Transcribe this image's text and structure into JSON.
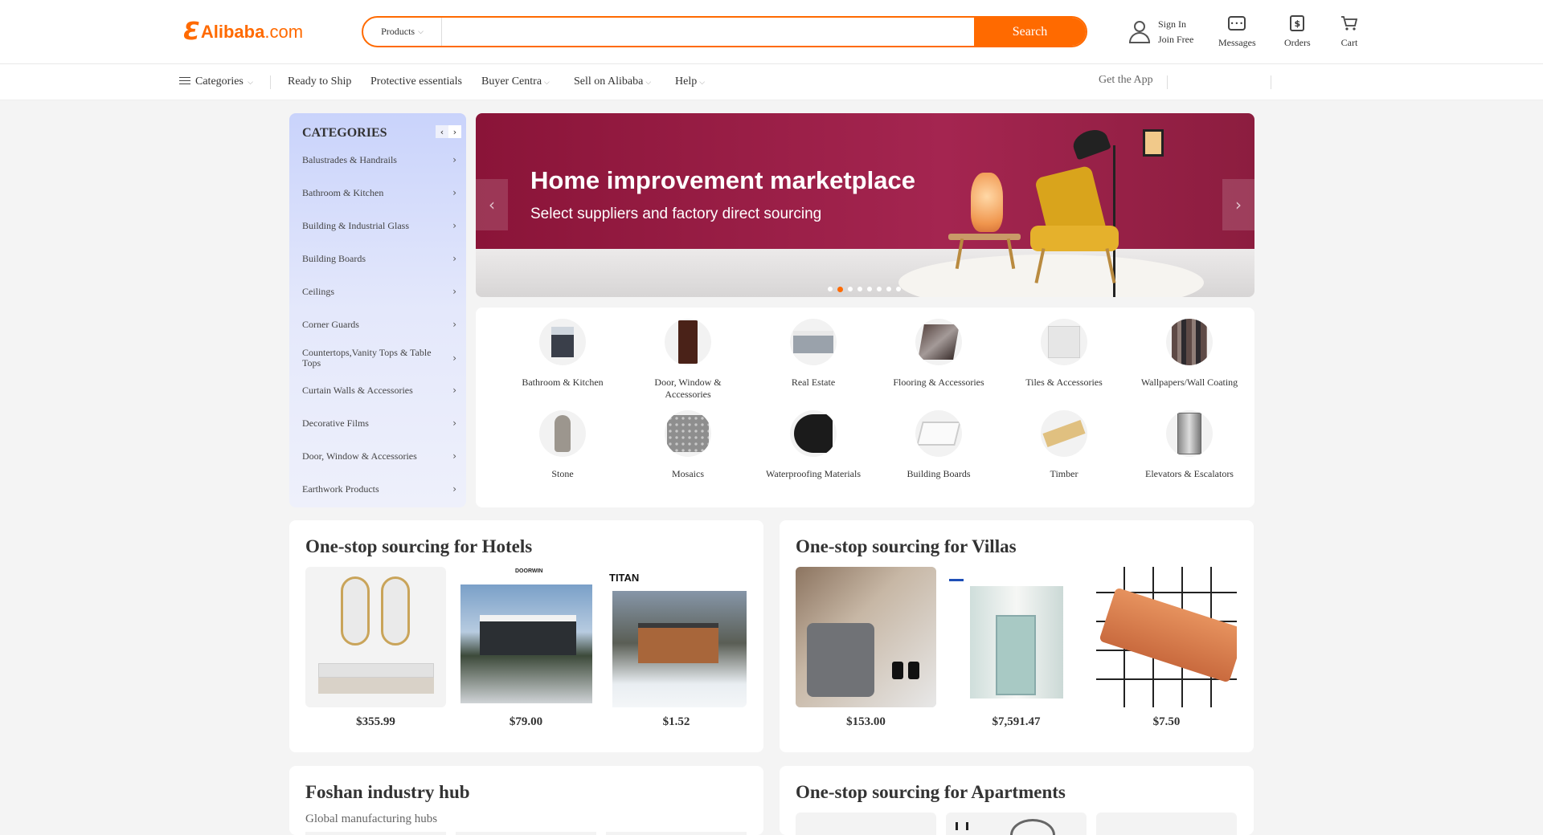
{
  "header": {
    "logo": {
      "mark": "Ɛ",
      "name": "Alibaba",
      "suffix": ".com"
    },
    "search": {
      "type_label": "Products",
      "placeholder": "",
      "button_label": "Search"
    },
    "user": {
      "sign_in": "Sign In",
      "join": "Join Free"
    },
    "tools": [
      {
        "label": "Messages",
        "icon": "message-icon"
      },
      {
        "label": "Orders",
        "icon": "orders-icon"
      },
      {
        "label": "Cart",
        "icon": "cart-icon"
      }
    ]
  },
  "subnav": {
    "categories": "Categories",
    "ready_to_ship": "Ready to Ship",
    "protective": "Protective essentials",
    "buyer_central": "Buyer Centra",
    "sell": "Sell on Alibaba",
    "help": "Help",
    "get_app": "Get the App"
  },
  "categories_panel": {
    "title": "CATEGORIES",
    "items": [
      "Balustrades & Handrails",
      "Bathroom & Kitchen",
      "Building & Industrial Glass",
      "Building Boards",
      "Ceilings",
      "Corner Guards",
      "Countertops,Vanity Tops & Table Tops",
      "Curtain Walls & Accessories",
      "Decorative Films",
      "Door, Window & Accessories",
      "Earthwork Products"
    ]
  },
  "banner": {
    "title": "Home improvement marketplace",
    "subtitle": "Select suppliers and factory direct sourcing",
    "slide_count": 8,
    "active_slide": 1
  },
  "category_grid": [
    "Bathroom & Kitchen",
    "Door, Window & Accessories",
    "Real Estate",
    "Flooring & Accessories",
    "Tiles & Accessories",
    "Wallpapers/Wall Coating",
    "Stone",
    "Mosaics",
    "Waterproofing Materials",
    "Building Boards",
    "Timber",
    "Elevators & Escalators"
  ],
  "hotels": {
    "title": "One-stop sourcing for Hotels",
    "products": [
      {
        "price": "$355.99",
        "logo": ""
      },
      {
        "price": "$79.00",
        "logo": "DOORWIN"
      },
      {
        "price": "$1.52",
        "logo": "TITAN"
      }
    ]
  },
  "villas": {
    "title": "One-stop sourcing for Villas",
    "products": [
      {
        "price": "$153.00"
      },
      {
        "price": "$7,591.47"
      },
      {
        "price": "$7.50"
      }
    ]
  },
  "foshan": {
    "title": "Foshan industry hub",
    "subtitle": "Global manufacturing hubs"
  },
  "apartments": {
    "title": "One-stop sourcing for Apartments"
  },
  "colors": {
    "brand": "#ff6a00",
    "banner": "#9c1f48",
    "panel": "#d6dcfb"
  }
}
